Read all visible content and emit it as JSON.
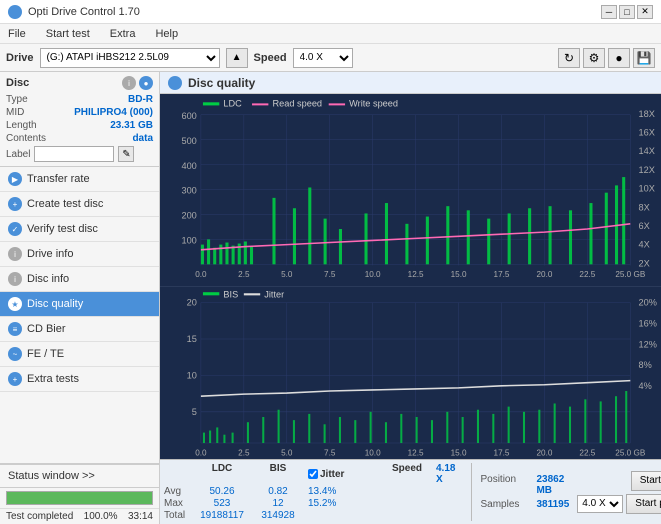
{
  "titleBar": {
    "title": "Opti Drive Control 1.70",
    "minBtn": "─",
    "maxBtn": "□",
    "closeBtn": "✕"
  },
  "menuBar": {
    "items": [
      "File",
      "Start test",
      "Extra",
      "Help"
    ]
  },
  "driveBar": {
    "label": "Drive",
    "driveValue": "(G:) ATAPI iHBS212 2.5L09",
    "speedLabel": "Speed",
    "speedValue": "4.0 X"
  },
  "disc": {
    "title": "Disc",
    "type_label": "Type",
    "type_value": "BD-R",
    "mid_label": "MID",
    "mid_value": "PHILIPRO4 (000)",
    "length_label": "Length",
    "length_value": "23.31 GB",
    "contents_label": "Contents",
    "contents_value": "data",
    "label_label": "Label",
    "label_value": ""
  },
  "navItems": [
    {
      "id": "transfer-rate",
      "label": "Transfer rate",
      "icon": "chart"
    },
    {
      "id": "create-test-disc",
      "label": "Create test disc",
      "icon": "disc"
    },
    {
      "id": "verify-test-disc",
      "label": "Verify test disc",
      "icon": "check"
    },
    {
      "id": "drive-info",
      "label": "Drive info",
      "icon": "info"
    },
    {
      "id": "disc-info",
      "label": "Disc info",
      "icon": "disc2"
    },
    {
      "id": "disc-quality",
      "label": "Disc quality",
      "icon": "star",
      "active": true
    },
    {
      "id": "cd-bier",
      "label": "CD Bier",
      "icon": "beer"
    },
    {
      "id": "fe-te",
      "label": "FE / TE",
      "icon": "wave"
    },
    {
      "id": "extra-tests",
      "label": "Extra tests",
      "icon": "plus"
    }
  ],
  "statusWindow": "Status window >>",
  "discQuality": {
    "title": "Disc quality"
  },
  "topChart": {
    "legend": [
      {
        "key": "LDC",
        "color": "#00ff00"
      },
      {
        "key": "Read speed",
        "color": "#ff69b4"
      },
      {
        "key": "Write speed",
        "color": "#ff69b4"
      }
    ],
    "yAxisLeft": [
      "600",
      "500",
      "400",
      "300",
      "200",
      "100"
    ],
    "yAxisRight": [
      "18X",
      "16X",
      "14X",
      "12X",
      "10X",
      "8X",
      "6X",
      "4X",
      "2X"
    ],
    "xAxis": [
      "0.0",
      "2.5",
      "5.0",
      "7.5",
      "10.0",
      "12.5",
      "15.0",
      "17.5",
      "20.0",
      "22.5",
      "25.0 GB"
    ]
  },
  "bottomChart": {
    "legend": [
      {
        "key": "BIS",
        "color": "#00ff00"
      },
      {
        "key": "Jitter",
        "color": "#ffffff"
      }
    ],
    "yAxisLeft": [
      "20",
      "15",
      "10",
      "5"
    ],
    "yAxisRight": [
      "20%",
      "16%",
      "12%",
      "8%",
      "4%"
    ],
    "xAxis": [
      "0.0",
      "2.5",
      "5.0",
      "7.5",
      "10.0",
      "12.5",
      "15.0",
      "17.5",
      "20.0",
      "22.5",
      "25.0 GB"
    ]
  },
  "statsRow": {
    "labels": [
      "LDC",
      "BIS",
      "Jitter",
      "Speed",
      ""
    ],
    "avg_ldc": "50.26",
    "avg_bis": "0.82",
    "avg_jitter": "13.4%",
    "speed_val": "4.18 X",
    "max_ldc": "523",
    "max_bis": "12",
    "max_jitter": "15.2%",
    "position_label": "Position",
    "position_val": "23862 MB",
    "total_ldc": "19188117",
    "total_bis": "314928",
    "samples_label": "Samples",
    "samples_val": "381195",
    "jitter_checked": true,
    "speed_dropdown": "4.0 X",
    "btn_start_full": "Start full",
    "btn_start_part": "Start part"
  },
  "progressBar": {
    "value": 100,
    "text": "100.0%",
    "timeText": "33:14"
  },
  "statusText": "Test completed"
}
